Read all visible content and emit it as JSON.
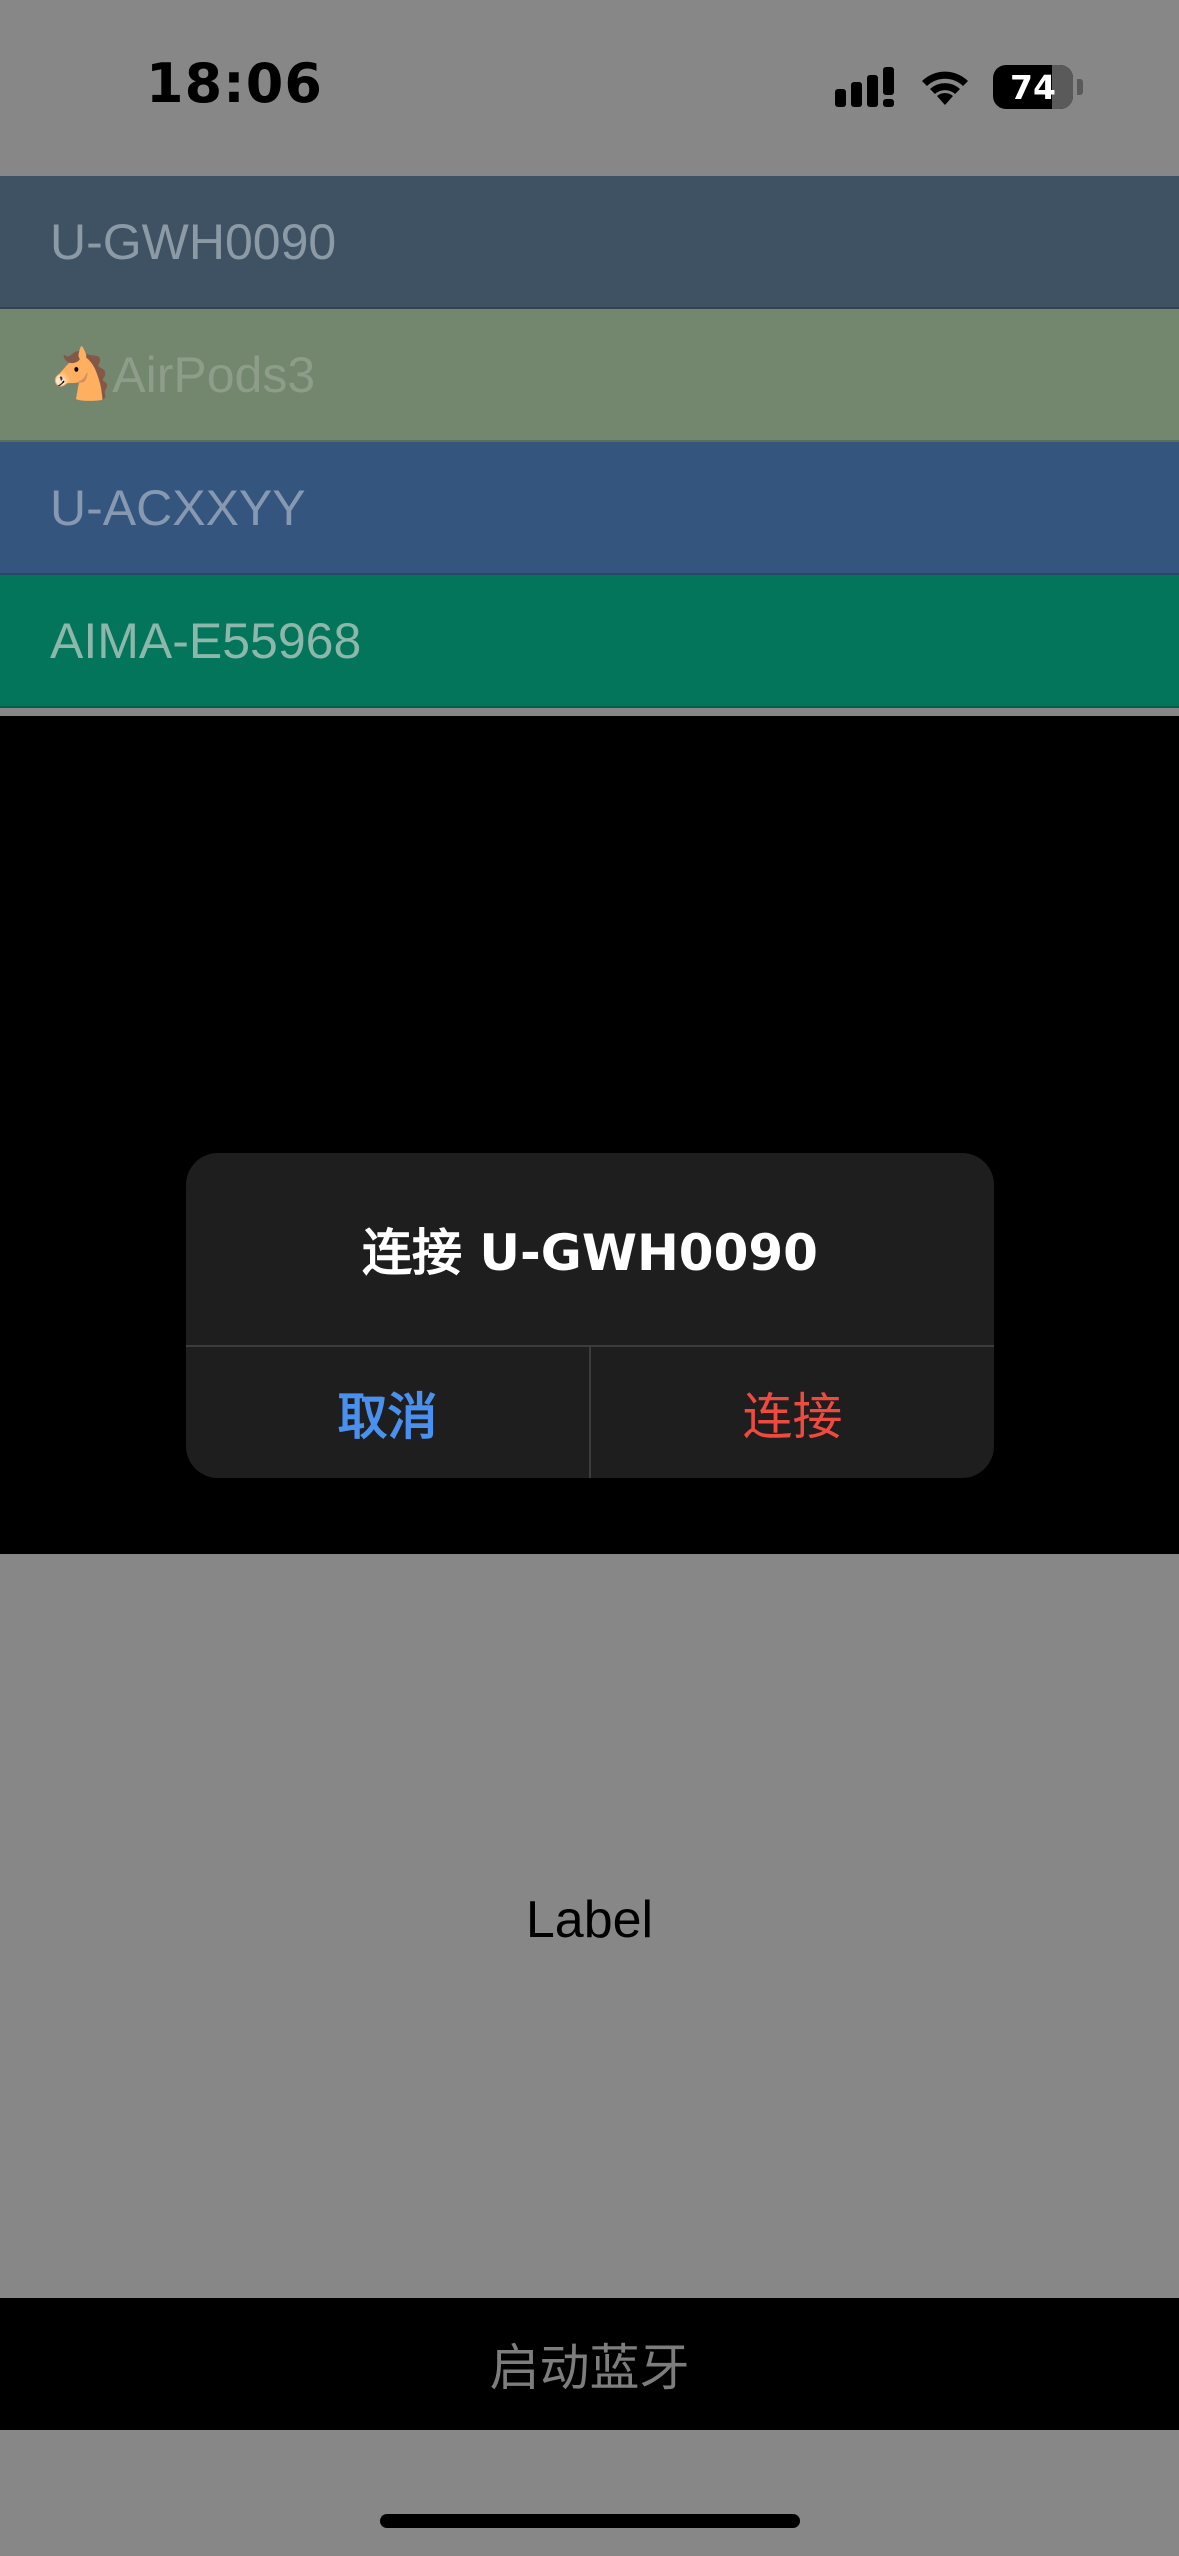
{
  "status_bar": {
    "time": "18:06",
    "battery": "74",
    "signal_icon": "cellular-signal-icon",
    "wifi_icon": "wifi-icon"
  },
  "devices": [
    {
      "name": "U-GWH0090",
      "icon": "",
      "color": "#3f5263"
    },
    {
      "name": "AirPods3",
      "icon": "🐴",
      "color": "#73866e"
    },
    {
      "name": "U-ACXXYY",
      "icon": "",
      "color": "#33557e"
    },
    {
      "name": "AIMA-E55968",
      "icon": "",
      "color": "#02755a"
    }
  ],
  "alert": {
    "title": "连接 U-GWH0090",
    "cancel_label": "取消",
    "confirm_label": "连接",
    "cancel_color": "#4a90ee",
    "confirm_color": "#ee4a40"
  },
  "main": {
    "label": "Label"
  },
  "bottom_button": {
    "label": "启动蓝牙"
  }
}
